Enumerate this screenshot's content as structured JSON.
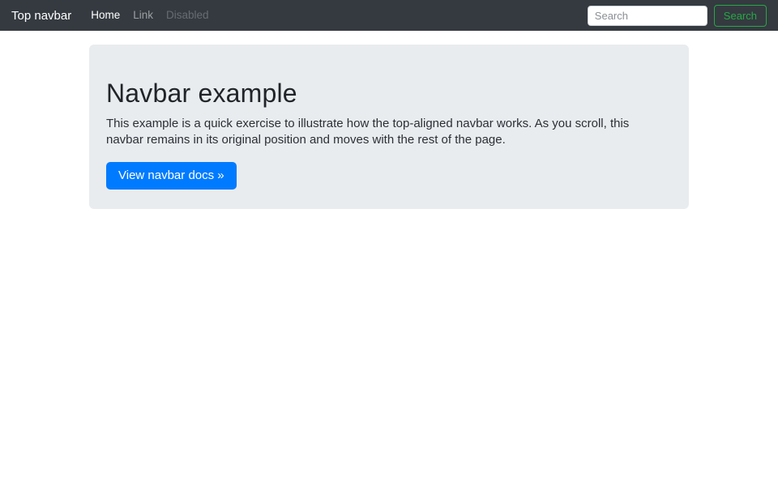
{
  "navbar": {
    "brand": "Top navbar",
    "items": [
      {
        "label": "Home",
        "state": "active"
      },
      {
        "label": "Link",
        "state": "normal"
      },
      {
        "label": "Disabled",
        "state": "disabled"
      }
    ],
    "search": {
      "placeholder": "Search",
      "value": "",
      "button_label": "Search"
    }
  },
  "jumbotron": {
    "title": "Navbar example",
    "body": "This example is a quick exercise to illustrate how the top-aligned navbar works. As you scroll, this navbar remains in its original position and moves with the rest of the page.",
    "cta_label": "View navbar docs »"
  },
  "colors": {
    "navbar_bg": "#343a40",
    "jumbotron_bg": "#e9ecef",
    "primary_blue": "#007bff",
    "success_green": "#28a745"
  }
}
